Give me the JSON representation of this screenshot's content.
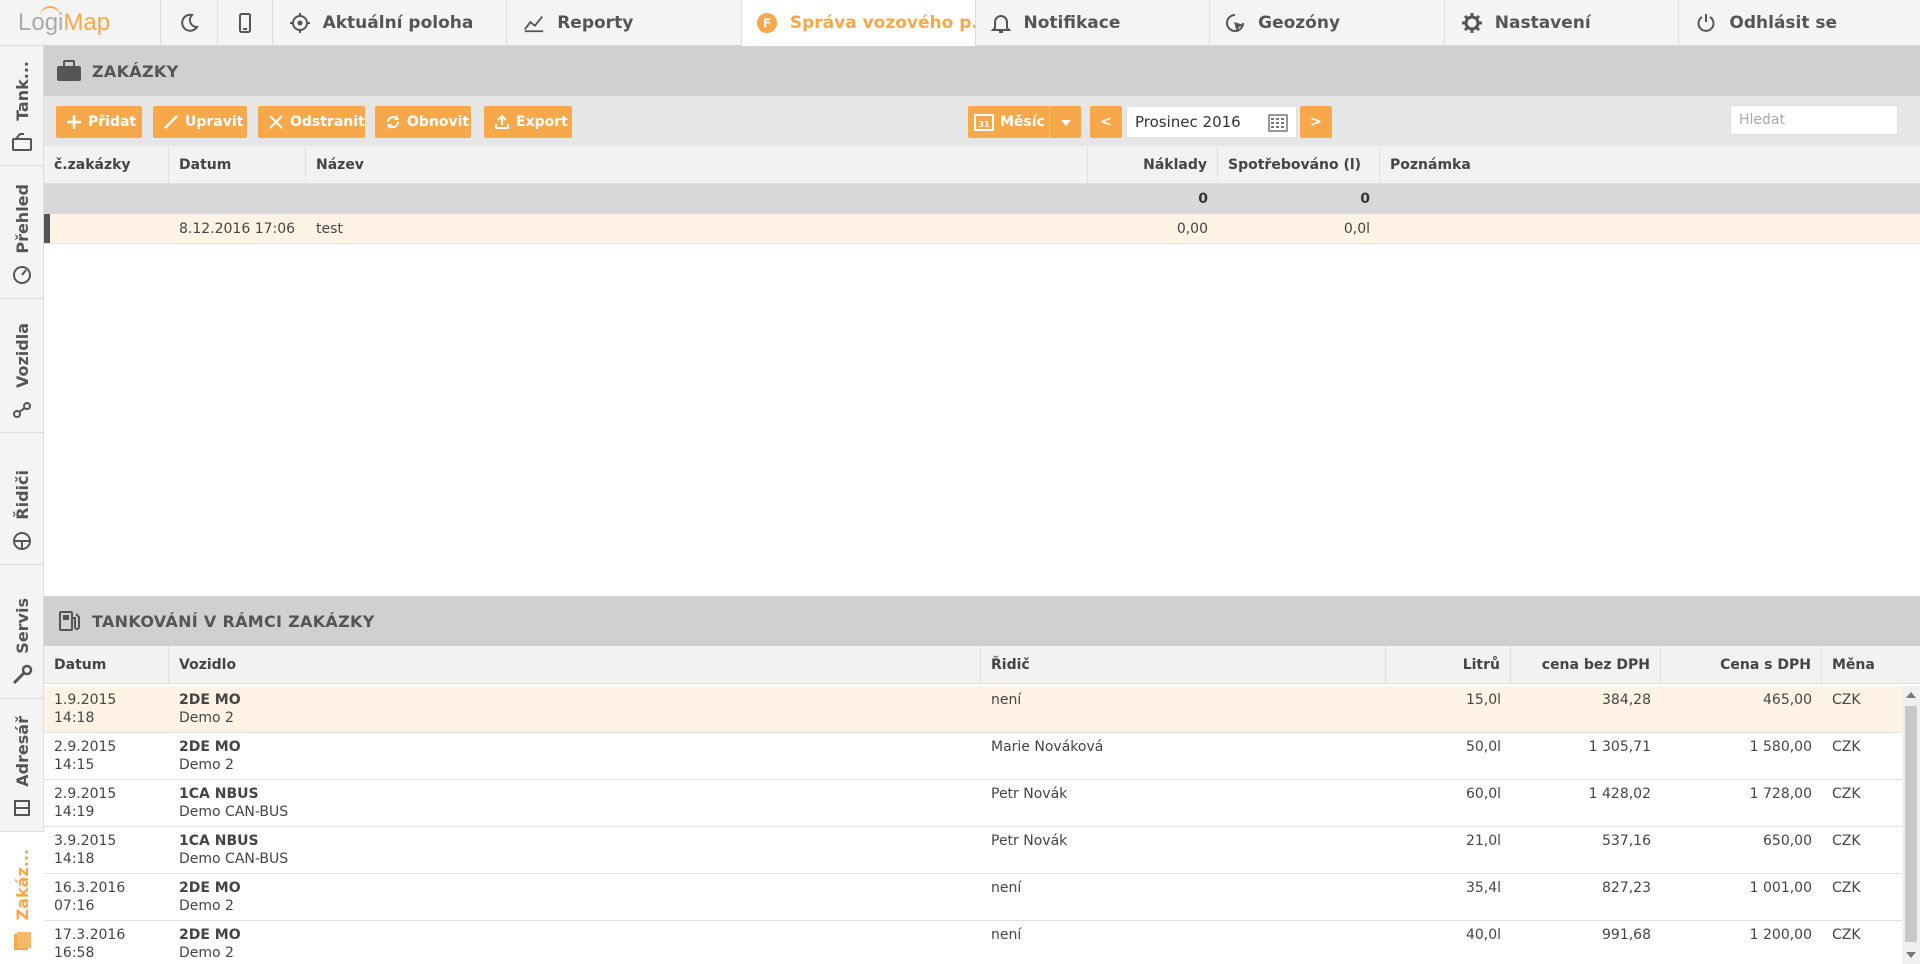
{
  "colors": {
    "accent": "#f7a84a",
    "header_gray": "#d0d0d0",
    "highlight_row": "#fff3e6"
  },
  "logo": {
    "part1": "Logi",
    "part2": "Map"
  },
  "nav": {
    "aktualni_poloha": "Aktuální poloha",
    "reporty": "Reporty",
    "sprava": "Správa vozového p...",
    "sprava_badge": "F",
    "notifikace": "Notifikace",
    "geozony": "Geozóny",
    "nastaveni": "Nastavení",
    "odhlasit": "Odhlásit se"
  },
  "sidebar": {
    "tank": "Tank...",
    "prehled": "Přehled",
    "vozidla": "Vozidla",
    "ridici": "Řidiči",
    "servis": "Servis",
    "adresar": "Adresář",
    "zakazky": "Zakáz..."
  },
  "orders": {
    "title": "ZAKÁZKY",
    "toolbar": {
      "add": "Přidat",
      "edit": "Upravit",
      "remove": "Odstranit",
      "refresh": "Obnovit",
      "export": "Export",
      "period": "Měsíc",
      "prev": "<",
      "next": ">",
      "date": "Prosinec 2016",
      "search_placeholder": "Hledat"
    },
    "columns": {
      "number": "č.zakázky",
      "date": "Datum",
      "name": "Název",
      "costs": "Náklady",
      "consumed": "Spotřebováno (l)",
      "note": "Poznámka"
    },
    "summary": {
      "costs": "0",
      "consumed": "0"
    },
    "rows": [
      {
        "number": "",
        "date": "8.12.2016 17:06",
        "name": "test",
        "costs": "0,00",
        "consumed": "0,0l",
        "note": ""
      }
    ]
  },
  "fueling": {
    "title": "TANKOVÁNÍ V RÁMCI ZAKÁZKY",
    "columns": {
      "date": "Datum",
      "vehicle": "Vozidlo",
      "driver": "Řidič",
      "liters": "Litrů",
      "price_net": "cena bez DPH",
      "price_gross": "Cena s DPH",
      "currency": "Měna"
    },
    "rows": [
      {
        "date": "1.9.2015",
        "time": "14:18",
        "plate": "2DE MO",
        "vehicle": "Demo 2",
        "driver": "není",
        "liters": "15,0l",
        "net": "384,28",
        "gross": "465,00",
        "currency": "CZK"
      },
      {
        "date": "2.9.2015",
        "time": "14:15",
        "plate": "2DE MO",
        "vehicle": "Demo 2",
        "driver": "Marie Nováková",
        "liters": "50,0l",
        "net": "1 305,71",
        "gross": "1 580,00",
        "currency": "CZK"
      },
      {
        "date": "2.9.2015",
        "time": "14:19",
        "plate": "1CA NBUS",
        "vehicle": "Demo CAN-BUS",
        "driver": "Petr Novák",
        "liters": "60,0l",
        "net": "1 428,02",
        "gross": "1 728,00",
        "currency": "CZK"
      },
      {
        "date": "3.9.2015",
        "time": "14:18",
        "plate": "1CA NBUS",
        "vehicle": "Demo CAN-BUS",
        "driver": "Petr Novák",
        "liters": "21,0l",
        "net": "537,16",
        "gross": "650,00",
        "currency": "CZK"
      },
      {
        "date": "16.3.2016",
        "time": "07:16",
        "plate": "2DE MO",
        "vehicle": "Demo 2",
        "driver": "není",
        "liters": "35,4l",
        "net": "827,23",
        "gross": "1 001,00",
        "currency": "CZK"
      },
      {
        "date": "17.3.2016",
        "time": "16:58",
        "plate": "2DE MO",
        "vehicle": "Demo 2",
        "driver": "není",
        "liters": "40,0l",
        "net": "991,68",
        "gross": "1 200,00",
        "currency": "CZK"
      }
    ]
  }
}
